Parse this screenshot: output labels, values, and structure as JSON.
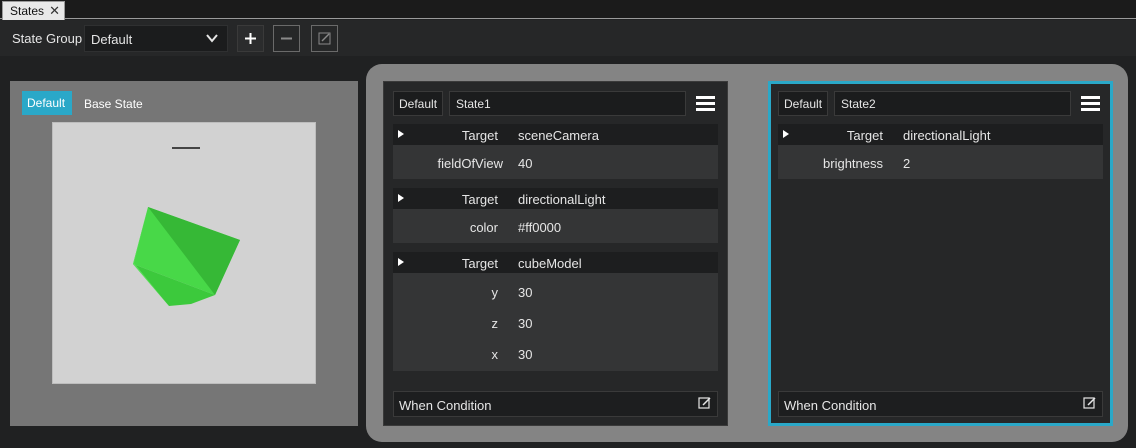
{
  "tab": {
    "title": "States",
    "close_glyph": "✕"
  },
  "toolbar": {
    "state_group_label": "State Group",
    "state_group_value": "Default",
    "add_glyph": "+",
    "remove_glyph": "−"
  },
  "base_state": {
    "badge": "Default",
    "label": "Base State"
  },
  "states": [
    {
      "badge": "Default",
      "name": "State1",
      "groups": [
        {
          "target_label": "Target",
          "target": "sceneCamera",
          "props": [
            {
              "key": "fieldOfView",
              "value": "40"
            }
          ]
        },
        {
          "target_label": "Target",
          "target": "directionalLight",
          "props": [
            {
              "key": "color",
              "value": "#ff0000"
            }
          ]
        },
        {
          "target_label": "Target",
          "target": "cubeModel",
          "props": [
            {
              "key": "y",
              "value": "30"
            },
            {
              "key": "z",
              "value": "30"
            },
            {
              "key": "x",
              "value": "30"
            }
          ]
        }
      ],
      "when_label": "When Condition"
    },
    {
      "badge": "Default",
      "name": "State2",
      "groups": [
        {
          "target_label": "Target",
          "target": "directionalLight",
          "props": [
            {
              "key": "brightness",
              "value": "2"
            }
          ]
        }
      ],
      "when_label": "When Condition"
    }
  ],
  "colors": {
    "accent": "#2aa8c8",
    "cube": "#3fcf3f",
    "background": "#202122"
  }
}
